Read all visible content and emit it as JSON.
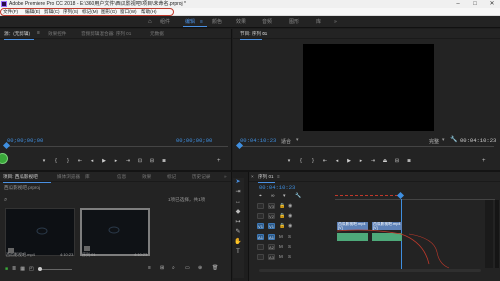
{
  "window": {
    "title": "Adobe Premiere Pro CC 2018 - E:\\360用户文件\\西瓜影视吧\\项目\\未命名.prproj *",
    "controls": [
      "minimize",
      "maximize",
      "close"
    ]
  },
  "menu": {
    "items": [
      "文件(F)",
      "编辑(E)",
      "剪辑(C)",
      "序列(S)",
      "标记(M)",
      "图形(G)",
      "窗口(W)",
      "帮助(H)"
    ]
  },
  "workspace": {
    "tabs": [
      "组件",
      "编辑",
      "颜色",
      "效果",
      "音频",
      "图形",
      "库"
    ],
    "active": "编辑",
    "more": "»"
  },
  "source_panel": {
    "tabs": [
      "源：(无剪辑)",
      "效果控件",
      "音频剪辑混合器: 序列 01",
      "元数据"
    ],
    "timecode": "00;00;00;00",
    "menu_icon": "≡"
  },
  "program_panel": {
    "title": "节目: 序列 01",
    "menu_icon": "≡",
    "timecode": "00:04:10:23",
    "fit": "适合",
    "quality": "完整",
    "duration": "00:04:10:23"
  },
  "project_panel": {
    "tabs": [
      "项目: 西瓜影视吧",
      "媒体浏览器",
      "库",
      "信息",
      "效果",
      "标记",
      "历史记录"
    ],
    "more": "»",
    "project_file": "西瓜影视吧.prproj",
    "status": "1项已选择，共1项",
    "items": [
      {
        "name": "西瓜影视吧.mp4",
        "duration": "4:10:23"
      },
      {
        "name": "序列 01",
        "duration": "4:10:23"
      }
    ]
  },
  "timeline": {
    "title": "序列 01",
    "menu_icon": "≡",
    "timecode": "00:04:10:23",
    "video_tracks": [
      "V3",
      "V2",
      "V1"
    ],
    "audio_tracks": [
      "A1",
      "A2",
      "A3"
    ],
    "clips": [
      {
        "label": "西瓜影视吧.mp4 [V]",
        "kind": "video"
      },
      {
        "label": "西瓜影视吧.mp4 [V]",
        "kind": "video"
      }
    ]
  },
  "colors": {
    "accent": "#4a90e2",
    "timecode": "#3f8fe0",
    "annotation": "#c0392b",
    "video_clip": "#5e82b8",
    "audio_clip": "#4ea97a",
    "playhead_green": "#3aa83a"
  }
}
